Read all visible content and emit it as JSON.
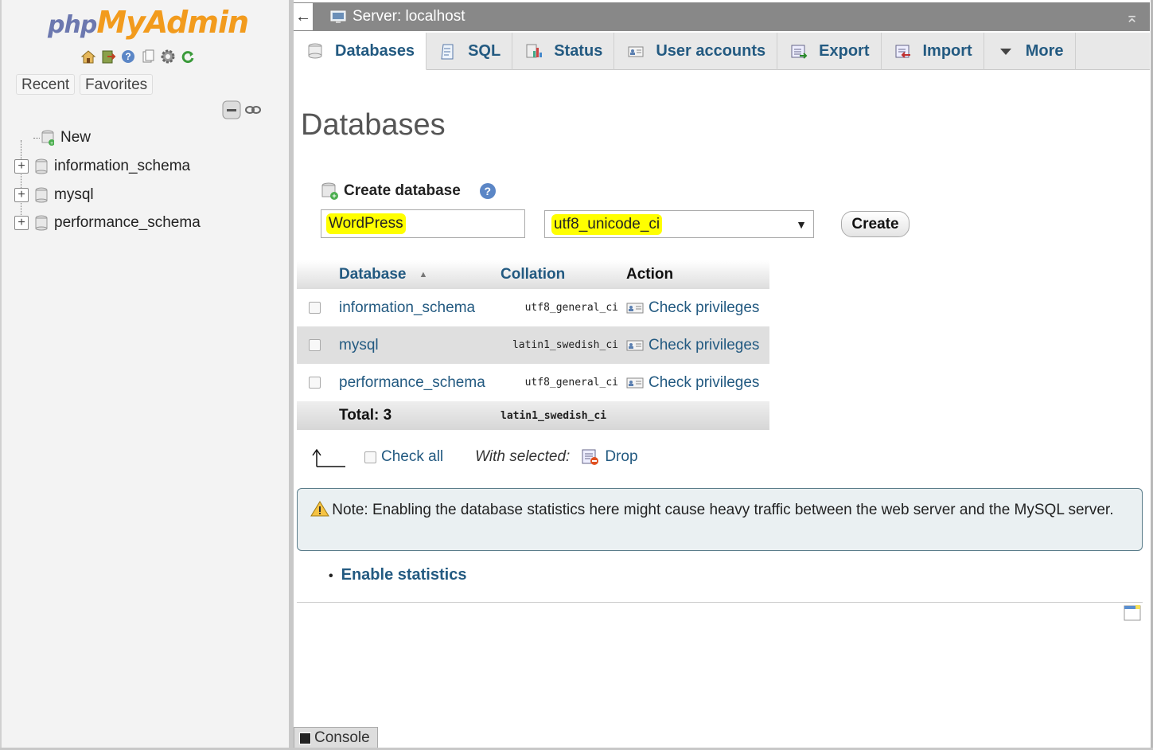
{
  "navigation": {
    "logo": {
      "php": "php",
      "my": "My",
      "admin": "Admin"
    },
    "tabs": [
      "Recent",
      "Favorites"
    ],
    "tree": [
      {
        "label": "New",
        "type": "new"
      },
      {
        "label": "information_schema",
        "type": "db"
      },
      {
        "label": "mysql",
        "type": "db"
      },
      {
        "label": "performance_schema",
        "type": "db"
      }
    ]
  },
  "topbar": {
    "back": "←",
    "server": "Server: localhost"
  },
  "tabs": [
    {
      "label": "Databases",
      "icon": "database-icon",
      "active": true
    },
    {
      "label": "SQL",
      "icon": "sql-icon"
    },
    {
      "label": "Status",
      "icon": "status-icon"
    },
    {
      "label": "User accounts",
      "icon": "users-icon"
    },
    {
      "label": "Export",
      "icon": "export-icon"
    },
    {
      "label": "Import",
      "icon": "import-icon"
    },
    {
      "label": "More",
      "icon": "chevron-down-icon"
    }
  ],
  "page": {
    "title": "Databases",
    "create": {
      "heading": "Create database",
      "name_value": "WordPress",
      "collation_value": "utf8_unicode_ci",
      "button": "Create"
    },
    "table": {
      "headers": {
        "database": "Database",
        "collation": "Collation",
        "action": "Action"
      },
      "rows": [
        {
          "name": "information_schema",
          "collation": "utf8_general_ci",
          "action": "Check privileges"
        },
        {
          "name": "mysql",
          "collation": "latin1_swedish_ci",
          "action": "Check privileges"
        },
        {
          "name": "performance_schema",
          "collation": "utf8_general_ci",
          "action": "Check privileges"
        }
      ],
      "total_label": "Total: 3",
      "total_collation": "latin1_swedish_ci"
    },
    "bulk": {
      "check_all": "Check all",
      "with_selected": "With selected:",
      "drop": "Drop"
    },
    "note": "Note: Enabling the database statistics here might cause heavy traffic between the web server and the MySQL server.",
    "enable_statistics": "Enable statistics",
    "console": "Console"
  },
  "colors": {
    "link": "#235a81",
    "highlight": "#ffff00",
    "topbar": "#888888"
  }
}
